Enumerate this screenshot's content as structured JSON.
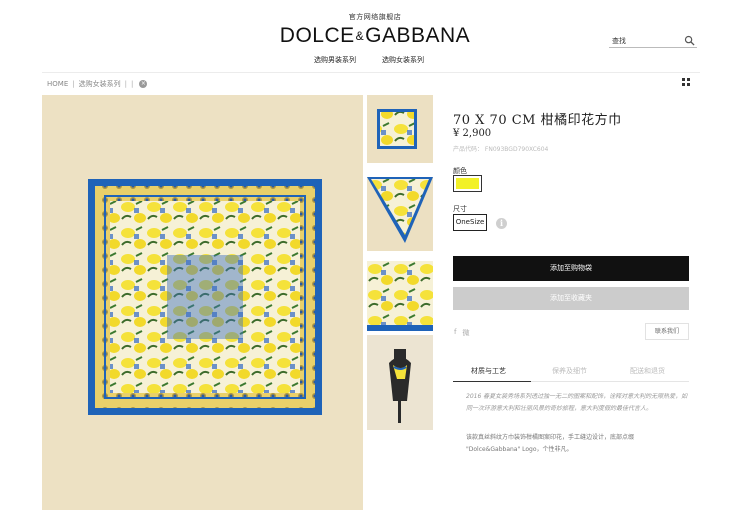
{
  "header": {
    "top_link": "官方网络旗舰店",
    "logo_left": "DOLCE",
    "logo_amp": "&",
    "logo_right": "GABBANA",
    "search_placeholder": "查找"
  },
  "nav": {
    "men": "选购男装系列",
    "women": "选购女装系列"
  },
  "breadcrumb": {
    "home": "HOME",
    "sep": "|",
    "category": "选购女装系列",
    "close": "×"
  },
  "product": {
    "title": "70 X 70 CM 柑橘印花方巾",
    "price": "¥ 2,900",
    "code": "产品代码： FN093BGD790XC604",
    "color_label": "颜色",
    "swatch_color": "#f2f127",
    "size_label": "尺寸",
    "size_value": "OneSize",
    "info_glyph": "i"
  },
  "actions": {
    "add_to_bag": "添加至购物袋",
    "add_to_favorites": "添加至收藏夹",
    "share_1": "f",
    "share_2": "微",
    "contact": "联系我们"
  },
  "tabs": [
    {
      "label": "材质与工艺"
    },
    {
      "label": "保养及细节"
    },
    {
      "label": "配送和退货"
    }
  ],
  "description": {
    "para1": "2016 春夏女装秀场系列透过独一无二的图案和配饰，诠释对意大利的无限热爱，如同一次环游意大利和壮丽风景的奇妙旅程，意大利度假的最佳代言人。",
    "para2": "该款真丝斜纹方巾装饰柑橘图案印花，手工缝边设计，底部点缀 \"Dolce&Gabbana\" Logo，个性非凡。"
  },
  "colors": {
    "scarf_border": "#1f63b8",
    "scarf_yellow": "#f5e23a",
    "bag_button": "#111111",
    "fav_button": "#cccccc"
  }
}
